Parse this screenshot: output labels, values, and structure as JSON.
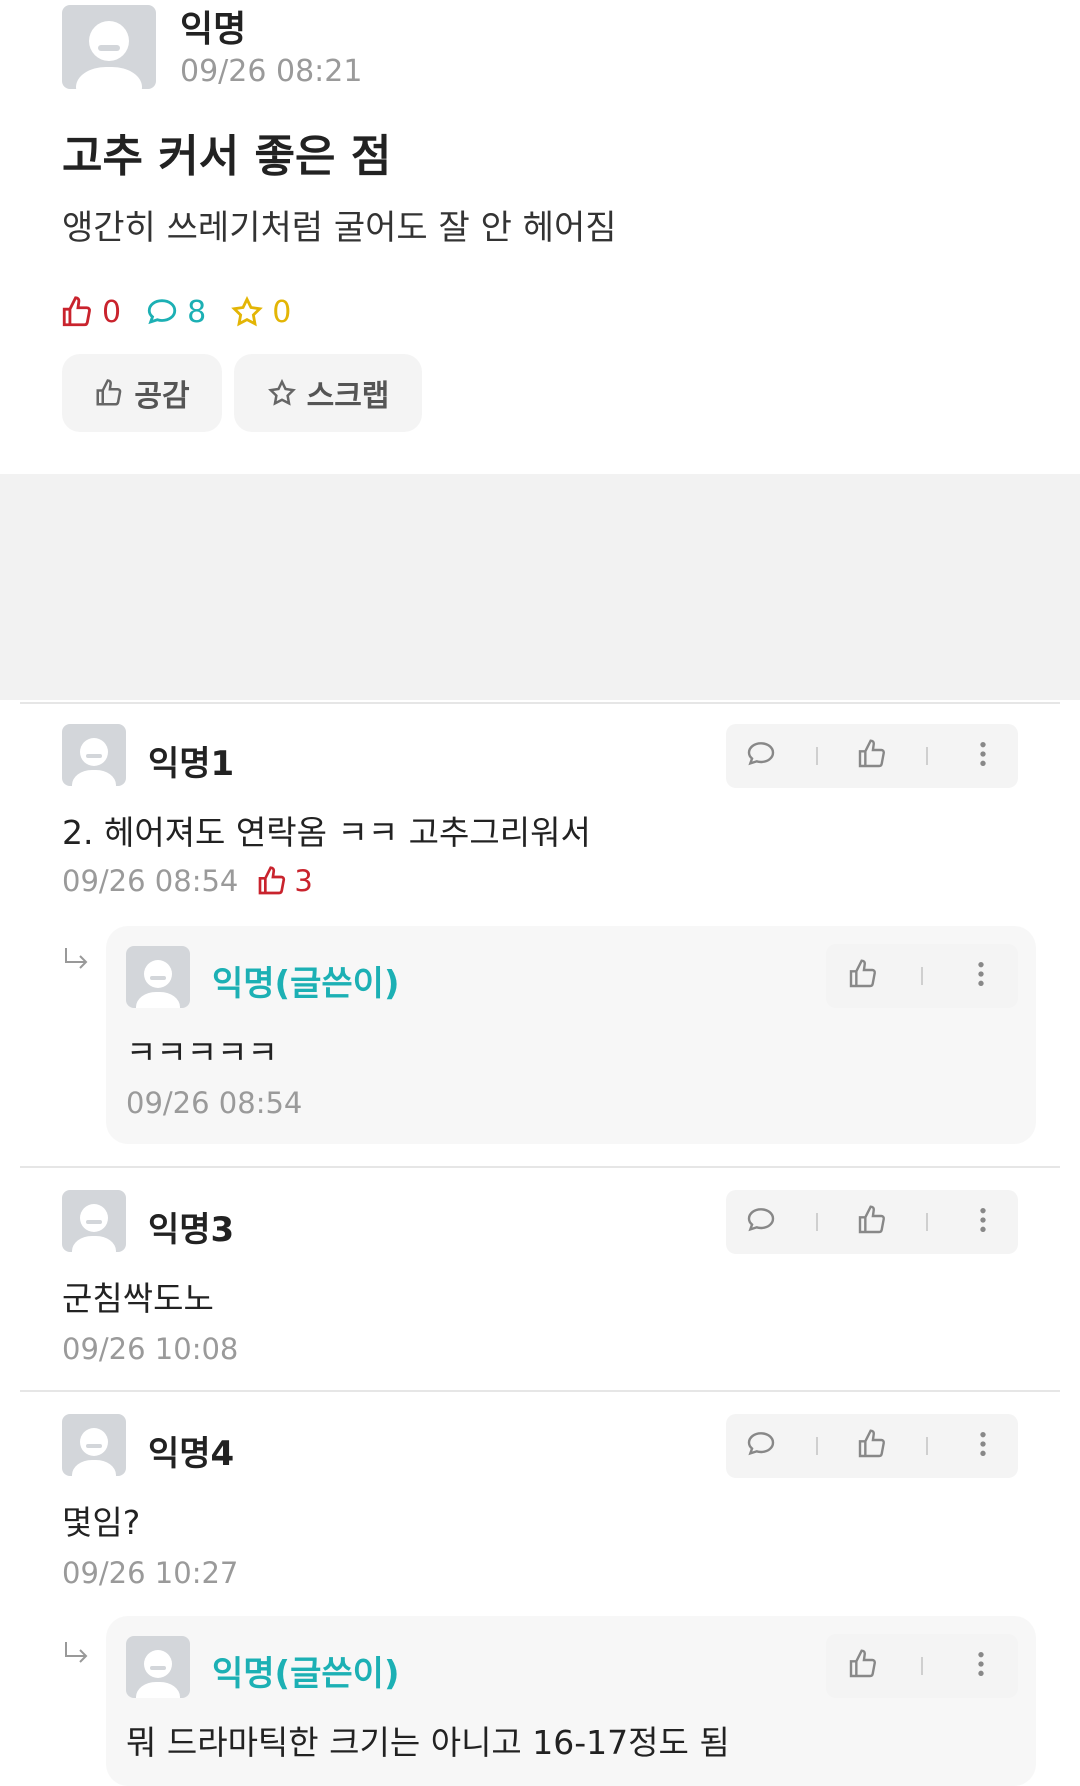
{
  "post": {
    "author": "익명",
    "time": "09/26 08:21",
    "title": "고추 커서 좋은 점",
    "body": "앵간히 쓰레기처럼 굴어도 잘 안 헤어짐",
    "likes": "0",
    "comments": "8",
    "scraps": "0",
    "like_button_label": "공감",
    "scrap_button_label": "스크랩"
  },
  "colors": {
    "like": "#c9232d",
    "comment": "#1cb0b4",
    "scrap": "#e3b505",
    "ad_bg": "#f2f2f2"
  },
  "comments": [
    {
      "author": "익명1",
      "text": "2. 헤어져도 연락옴 ㅋㅋ 고추그리워서",
      "time": "09/26 08:54",
      "likes": "3"
    },
    {
      "author": "익명(글쓴이)",
      "text": "ㅋㅋㅋㅋㅋ",
      "time": "09/26 08:54"
    },
    {
      "author": "익명3",
      "text": "군침싹도노",
      "time": "09/26 10:08"
    },
    {
      "author": "익명4",
      "text": "몇임?",
      "time": "09/26 10:27"
    },
    {
      "author": "익명(글쓴이)",
      "text": "뭐 드라마틱한 크기는 아니고 16-17정도 됨"
    }
  ]
}
